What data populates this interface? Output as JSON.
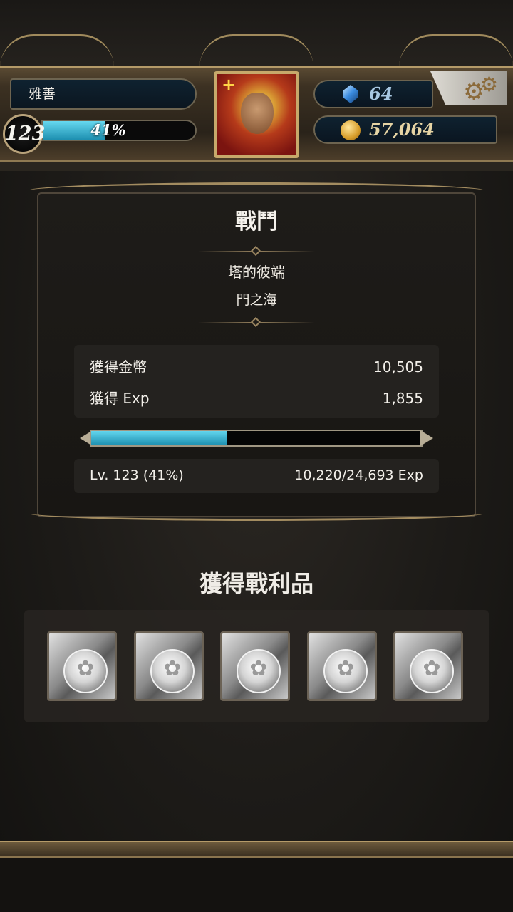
{
  "player": {
    "name": "雅善",
    "level": "123",
    "xp_percent_label": "41%",
    "xp_fraction": 0.41
  },
  "currency": {
    "gems": "64",
    "gold": "57,064"
  },
  "battle": {
    "title": "戰鬥",
    "stage_name": "塔的彼端",
    "stage_sub": "門之海",
    "rewards": [
      {
        "label": "獲得金幣",
        "value": "10,505"
      },
      {
        "label": "獲得 Exp",
        "value": "1,855"
      }
    ],
    "level_label": "Lv. 123 (41%)",
    "exp_label": "10,220/24,693 Exp",
    "exp_fraction": 0.41
  },
  "loot": {
    "title": "獲得戰利品",
    "items": [
      "silver-coin-card-icon",
      "silver-coin-card-icon",
      "silver-coin-card-icon",
      "silver-coin-card-icon",
      "silver-coin-card-icon"
    ]
  },
  "colors": {
    "accent_cyan": "#2fb7d6",
    "gold_trim": "#b49a68"
  }
}
